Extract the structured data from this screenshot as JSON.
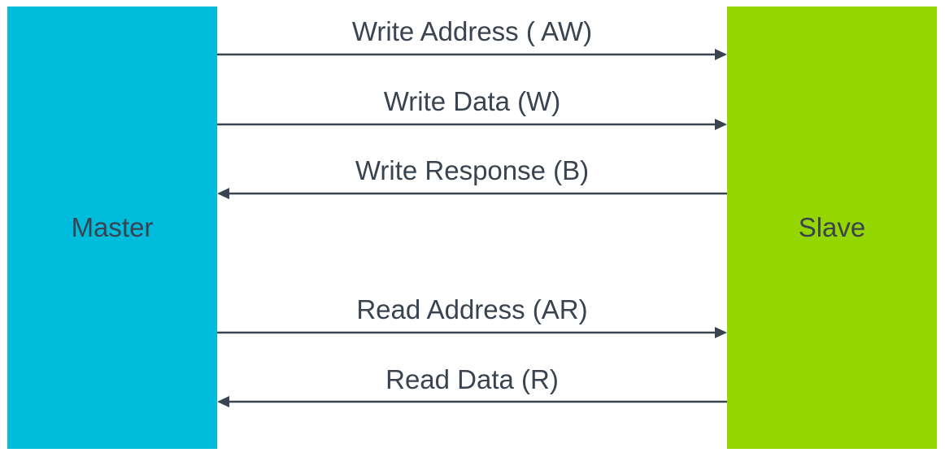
{
  "master": {
    "label": "Master",
    "color": "#00bcdc"
  },
  "slave": {
    "label": "Slave",
    "color": "#95d600"
  },
  "line_color": "#3a4450",
  "channels": [
    {
      "label": "Write Address ( AW)",
      "direction": "master-to-slave"
    },
    {
      "label": "Write Data (W)",
      "direction": "master-to-slave"
    },
    {
      "label": "Write Response (B)",
      "direction": "slave-to-master"
    },
    {
      "label": "Read Address (AR)",
      "direction": "master-to-slave"
    },
    {
      "label": "Read Data (R)",
      "direction": "slave-to-master"
    }
  ]
}
